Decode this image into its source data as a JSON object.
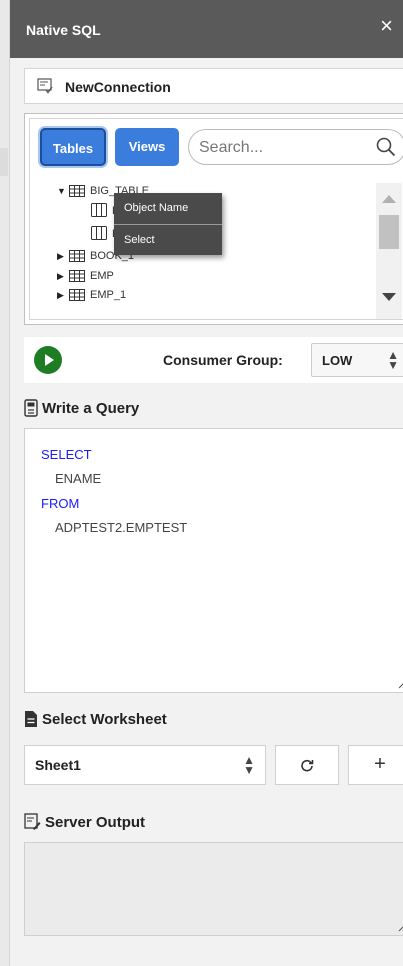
{
  "window": {
    "title": "Native SQL",
    "close_glyph": "×"
  },
  "connection": {
    "name": "NewConnection",
    "icon": "connection-icon"
  },
  "object_browser": {
    "tabs": [
      {
        "label": "Tables",
        "active": true
      },
      {
        "label": "Views",
        "active": false
      }
    ],
    "search": {
      "placeholder": "Search..."
    },
    "tree": [
      {
        "label": "BIG_TABLE",
        "expanded": true,
        "type": "table"
      },
      {
        "label": "B",
        "type": "column"
      },
      {
        "label": "B",
        "type": "column"
      },
      {
        "label": "BOOK_1",
        "expanded": false,
        "type": "table"
      },
      {
        "label": "EMP",
        "expanded": false,
        "type": "table"
      },
      {
        "label": "EMP_1",
        "expanded": false,
        "type": "table"
      }
    ],
    "context_menu": [
      "Object Name",
      "Select"
    ]
  },
  "consumer_group": {
    "label": "Consumer Group:",
    "value": "LOW"
  },
  "query": {
    "heading": "Write a Query",
    "lines": [
      {
        "text": "SELECT",
        "kind": "keyword"
      },
      {
        "text": "ENAME",
        "kind": "identifier"
      },
      {
        "text": "FROM",
        "kind": "keyword"
      },
      {
        "text": "ADPTEST2.EMPTEST",
        "kind": "identifier"
      }
    ]
  },
  "worksheet": {
    "heading": "Select Worksheet",
    "selected": "Sheet1",
    "add_label": "+"
  },
  "server_output": {
    "heading": "Server Output",
    "text": ""
  },
  "colors": {
    "title_bar": "#5a5a5a",
    "accent": "#3b7ddd",
    "keyword": "#1a1aff",
    "run_button": "#1e7d22"
  }
}
